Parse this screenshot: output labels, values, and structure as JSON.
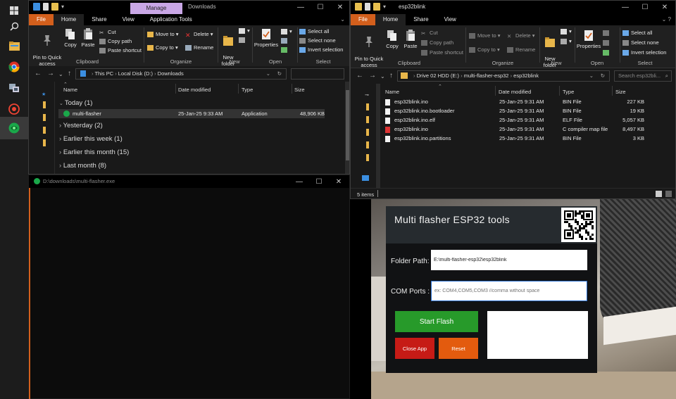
{
  "left_window": {
    "contextual_tab": "Manage",
    "title": "Downloads",
    "tabs": [
      "File",
      "Home",
      "Share",
      "View",
      "Application Tools"
    ],
    "ribbon": {
      "pin": "Pin to Quick\naccess",
      "copy": "Copy",
      "paste": "Paste",
      "cut": "Cut",
      "copy_path": "Copy path",
      "paste_shortcut": "Paste shortcut",
      "move_to": "Move to",
      "copy_to": "Copy to",
      "delete": "Delete",
      "rename": "Rename",
      "new_folder": "New\nfolder",
      "properties": "Properties",
      "select_all": "Select all",
      "select_none": "Select none",
      "invert_selection": "Invert selection",
      "groups": [
        "Clipboard",
        "Organize",
        "New",
        "Open",
        "Select"
      ]
    },
    "breadcrumb": [
      "This PC",
      "Local Disk (D:)",
      "Downloads"
    ],
    "columns": [
      "Name",
      "Date modified",
      "Type",
      "Size"
    ],
    "groups": [
      {
        "label": "Today (1)"
      },
      {
        "label": "Yesterday (2)"
      },
      {
        "label": "Earlier this week (1)"
      },
      {
        "label": "Earlier this month (15)"
      },
      {
        "label": "Last month (8)"
      }
    ],
    "file": {
      "name": "multi-flasher",
      "date": "25-Jan-25 9:33 AM",
      "type": "Application",
      "size": "48,906 KB"
    }
  },
  "console": {
    "title": "D:\\downloads\\multi-flasher.exe"
  },
  "right_window": {
    "title": "esp32blink",
    "tabs": [
      "File",
      "Home",
      "Share",
      "View"
    ],
    "ribbon": {
      "pin": "Pin to Quick\naccess",
      "copy": "Copy",
      "paste": "Paste",
      "cut": "Cut",
      "copy_path": "Copy path",
      "paste_shortcut": "Paste shortcut",
      "move_to": "Move to",
      "copy_to": "Copy to",
      "delete": "Delete",
      "rename": "Rename",
      "new_folder": "New\nfolder",
      "properties": "Properties",
      "select_all": "Select all",
      "select_none": "Select none",
      "invert_selection": "Invert selection",
      "groups": [
        "Clipboard",
        "Organize",
        "New",
        "Open",
        "Select"
      ]
    },
    "breadcrumb": [
      "Drive 02 HDD (E:)",
      "multi-flasher-esp32",
      "esp32blink"
    ],
    "search_placeholder": "Search esp32bli...",
    "columns": [
      "Name",
      "Date modified",
      "Type",
      "Size"
    ],
    "files": [
      {
        "name": "esp32blink.ino",
        "date": "25-Jan-25 9:31 AM",
        "type": "BIN File",
        "size": "227 KB"
      },
      {
        "name": "esp32blink.ino.bootloader",
        "date": "25-Jan-25 9:31 AM",
        "type": "BIN File",
        "size": "19 KB"
      },
      {
        "name": "esp32blink.ino.elf",
        "date": "25-Jan-25 9:31 AM",
        "type": "ELF File",
        "size": "5,057 KB"
      },
      {
        "name": "esp32blink.ino",
        "date": "25-Jan-25 9:31 AM",
        "type": "C compiler map file",
        "size": "8,497 KB"
      },
      {
        "name": "esp32blink.ino.partitions",
        "date": "25-Jan-25 9:31 AM",
        "type": "BIN File",
        "size": "3 KB"
      }
    ],
    "status": "5 items"
  },
  "app": {
    "title": "Multi flasher ESP32 tools",
    "folder_label": "Folder Path:",
    "folder_value": "E:\\multi-flasher-esp32\\esp32blink",
    "com_label": "COM Ports :",
    "com_placeholder": "ex: COM4,COM5,COM3 //comma without space",
    "start_label": "Start Flash",
    "close_label": "Close App",
    "reset_label": "Reset",
    "colors": {
      "start": "#279a2a",
      "close": "#c61b16",
      "reset": "#e35b0e"
    }
  }
}
